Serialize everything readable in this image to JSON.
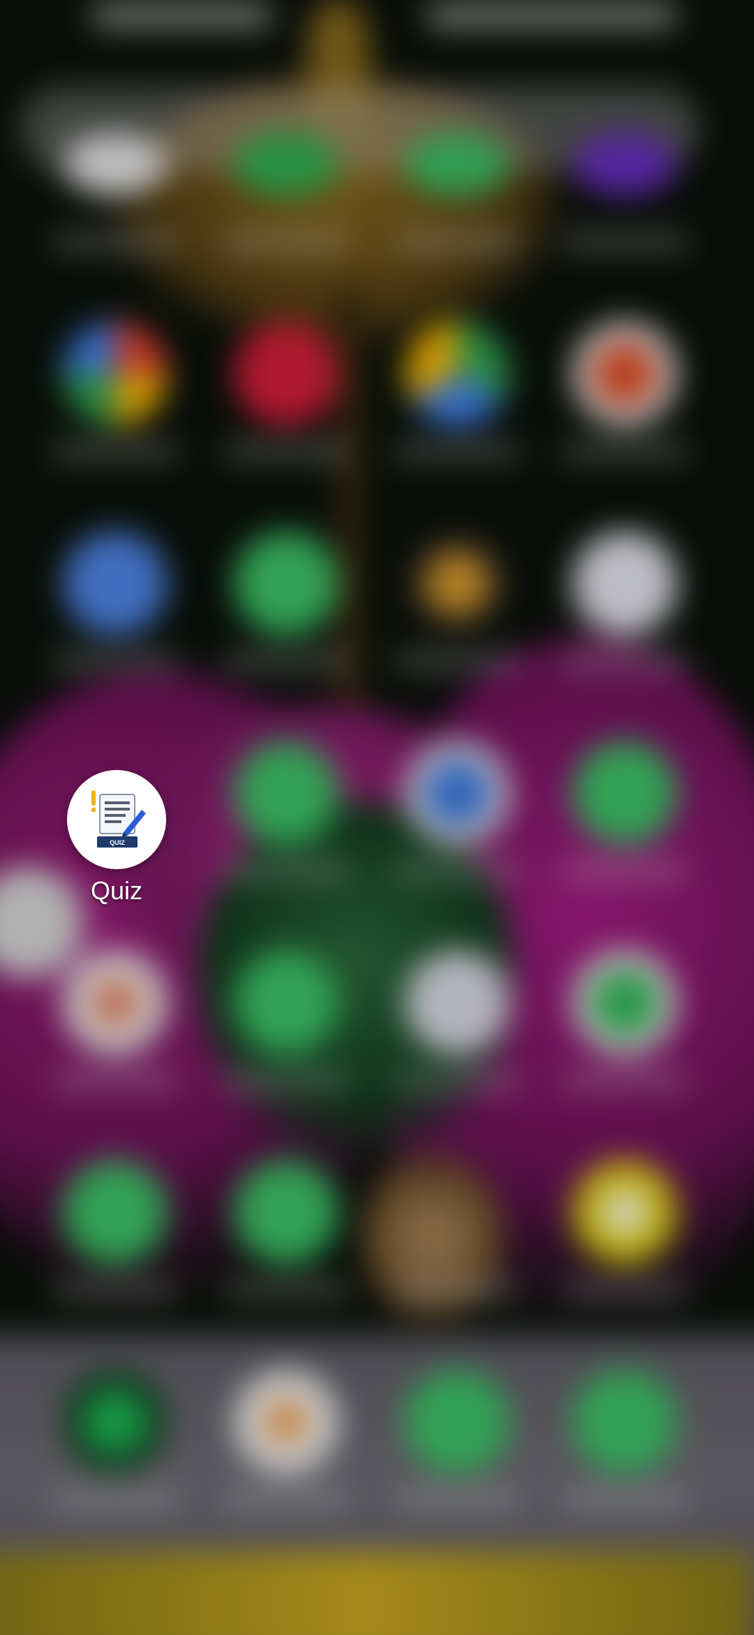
{
  "app": {
    "label": "Quiz",
    "icon": "quiz-document-icon",
    "icon_badge_text": "QUIZ"
  },
  "colors": {
    "quiz_icon_bg": "#ffffff",
    "quiz_icon_badge": "#1e3a6e",
    "quiz_icon_pen": "#2a5bd7",
    "quiz_icon_exclamation": "#f2b01e"
  }
}
